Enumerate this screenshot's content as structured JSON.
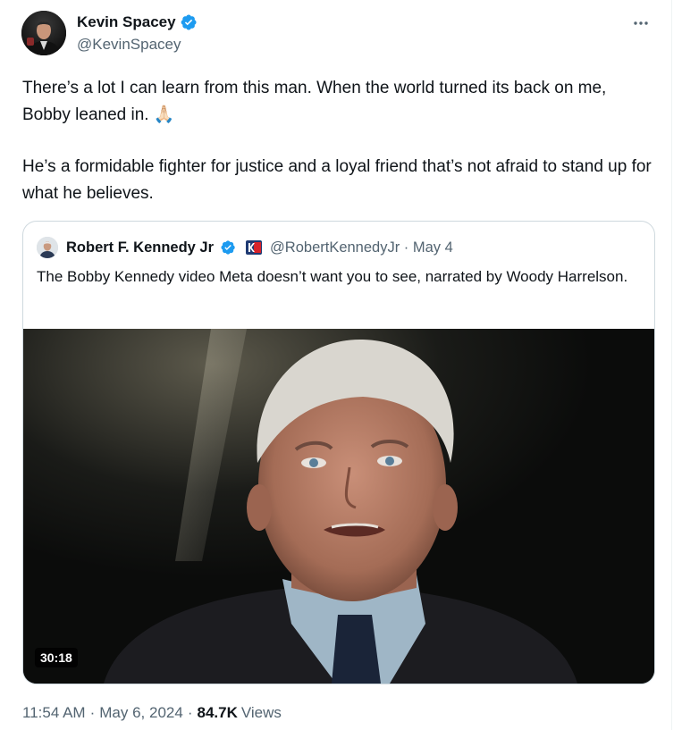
{
  "tweet": {
    "display_name": "Kevin Spacey",
    "handle": "@KevinSpacey",
    "paragraph_1": "There’s a lot I can learn from this man. When the world turned its back on me, Bobby leaned in. 🙏🏻",
    "paragraph_2": "He’s a formidable fighter for justice and a loyal friend that’s not afraid to stand up for what he believes.",
    "more_icon": "more-horizontal-icon",
    "verified_icon": "verified-badge-icon"
  },
  "quote": {
    "display_name": "Robert F. Kennedy Jr",
    "handle_date": "@RobertKennedyJr · May 4",
    "text": "The Bobby Kennedy video Meta doesn’t want you to see, narrated by Woody Harrelson.",
    "video_duration": "30:18"
  },
  "meta": {
    "time": "11:54 AM",
    "date": "May 6, 2024",
    "views_count": "84.7K",
    "views_label": "Views"
  },
  "colors": {
    "verified_blue": "#1d9bf0",
    "secondary_text": "#536471",
    "border": "#cfd9de"
  }
}
